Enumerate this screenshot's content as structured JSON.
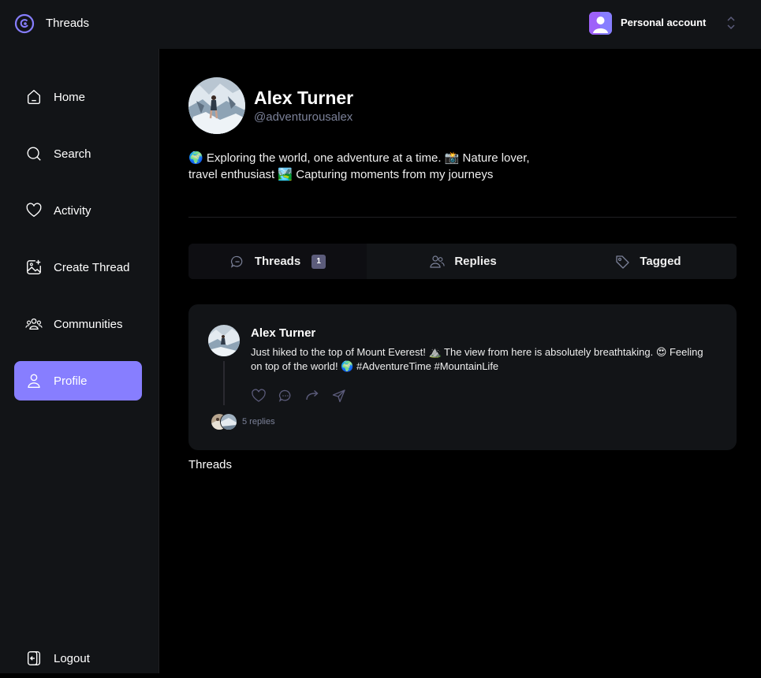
{
  "app": {
    "title": "Threads"
  },
  "account": {
    "label": "Personal account"
  },
  "nav": {
    "items": [
      {
        "label": "Home",
        "icon": "home-icon"
      },
      {
        "label": "Search",
        "icon": "search-icon"
      },
      {
        "label": "Activity",
        "icon": "heart-icon"
      },
      {
        "label": "Create Thread",
        "icon": "image-plus-icon"
      },
      {
        "label": "Communities",
        "icon": "users-icon"
      },
      {
        "label": "Profile",
        "icon": "user-icon",
        "active": true
      }
    ],
    "logout": "Logout"
  },
  "profile": {
    "name": "Alex Turner",
    "handle": "@adventurousalex",
    "bio": "🌍 Exploring the world, one adventure at a time. 📸 Nature lover, travel enthusiast 🏞️ Capturing moments from my journeys"
  },
  "tabs": [
    {
      "label": "Threads",
      "count": "1",
      "active": true
    },
    {
      "label": "Replies"
    },
    {
      "label": "Tagged"
    }
  ],
  "thread": {
    "author": "Alex Turner",
    "text": "Just hiked to the top of Mount Everest! ⛰️ The view from here is absolutely breathtaking. 😍 Feeling on top of the world! 🌍 #AdventureTime #MountainLife",
    "replies": "5 replies"
  },
  "footer": {
    "label": "Threads"
  },
  "colors": {
    "accent": "#877EFF",
    "sidebar": "#121417",
    "muted": "#7B8198"
  }
}
